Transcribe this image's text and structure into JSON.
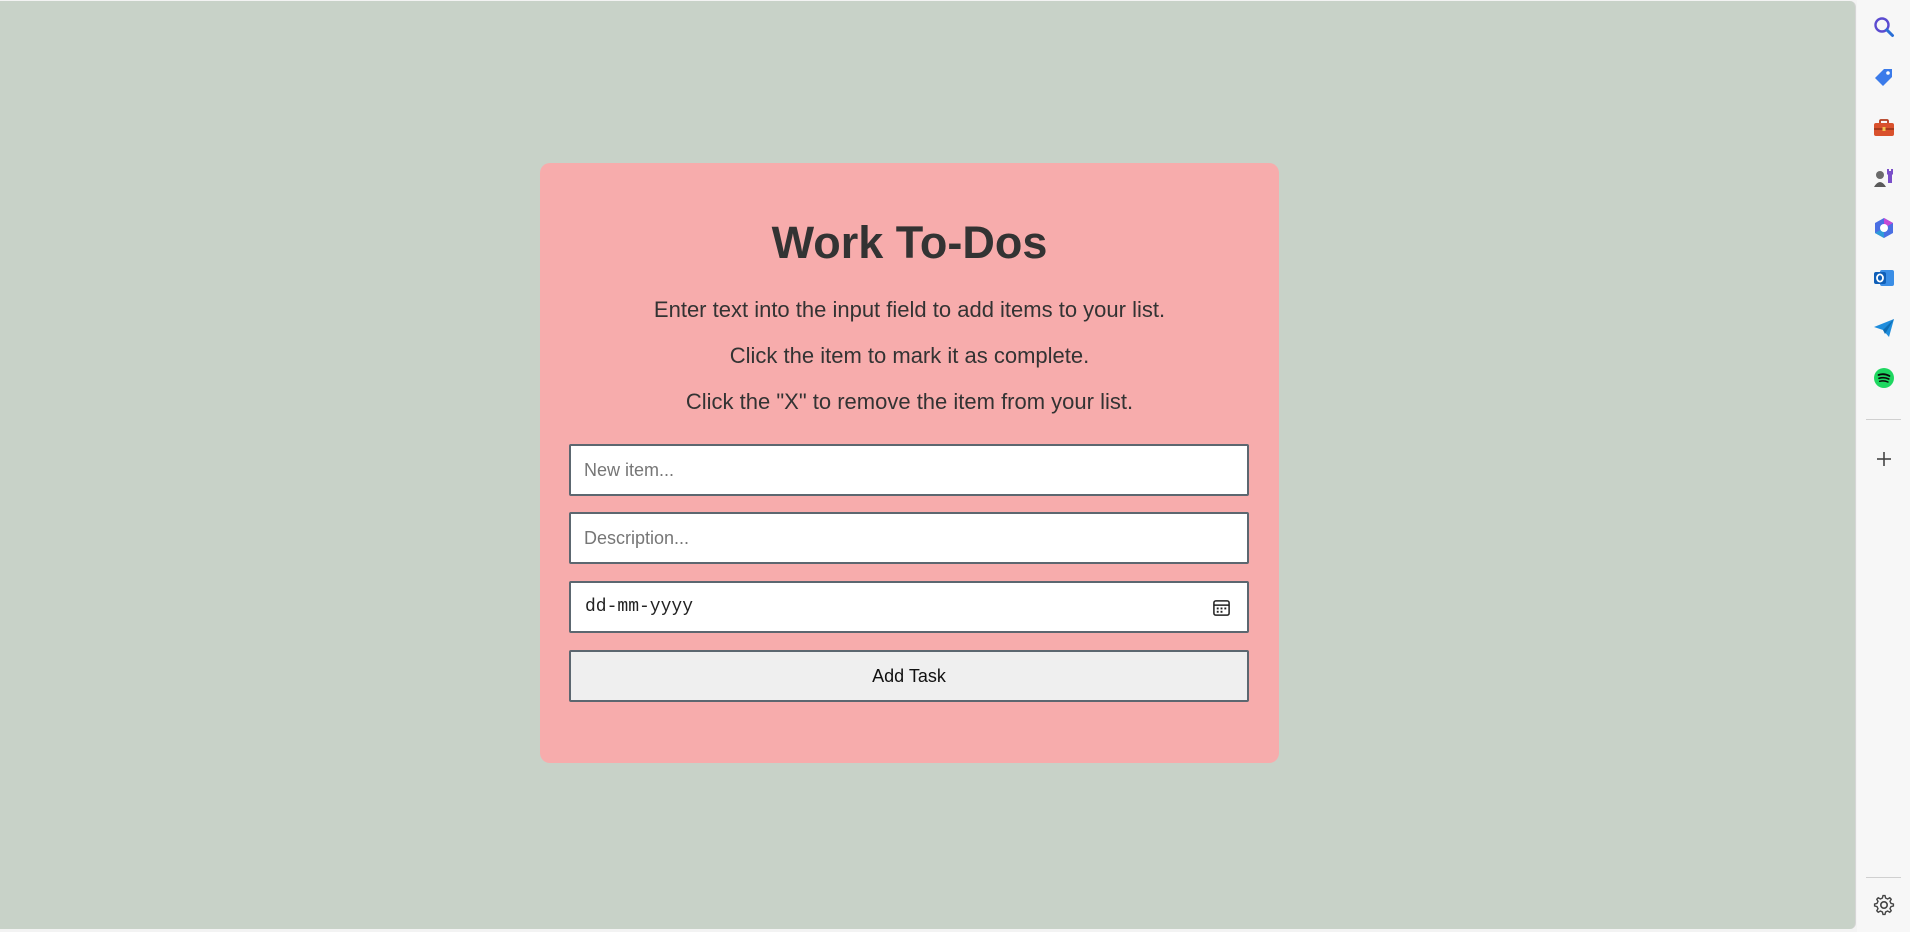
{
  "card": {
    "title": "Work To-Dos",
    "instructions": [
      "Enter text into the input field to add items to your list.",
      "Click the item to mark it as complete.",
      "Click the \"X\" to remove the item from your list."
    ],
    "new_item_placeholder": "New item...",
    "description_placeholder": "Description...",
    "date_placeholder": "dd-mm-yyyy",
    "add_button_label": "Add Task"
  },
  "colors": {
    "page_background": "#c8d2c8",
    "card_background": "#f7acac",
    "text": "#333333"
  },
  "sidebar": {
    "icons": [
      "search-icon",
      "shopping-tag-icon",
      "toolbox-icon",
      "games-icon",
      "copilot-icon",
      "outlook-icon",
      "send-icon",
      "spotify-icon",
      "add-icon",
      "settings-icon"
    ]
  }
}
